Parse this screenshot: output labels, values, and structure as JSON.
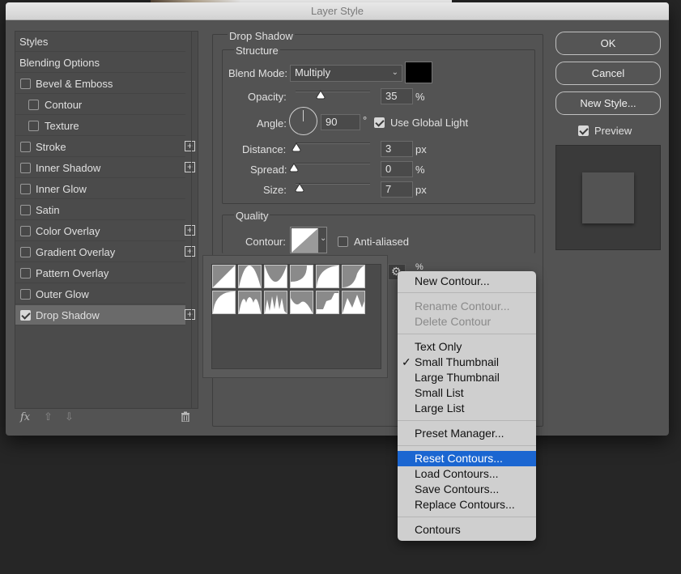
{
  "window": {
    "title": "Layer Style"
  },
  "styles_list": {
    "items": [
      {
        "label": "Styles",
        "checkbox": false,
        "checked": false,
        "plus": false,
        "indent": 0,
        "selected": false
      },
      {
        "label": "Blending Options",
        "checkbox": false,
        "checked": false,
        "plus": false,
        "indent": 0,
        "selected": false
      },
      {
        "label": "Bevel & Emboss",
        "checkbox": true,
        "checked": false,
        "plus": false,
        "indent": 0,
        "selected": false
      },
      {
        "label": "Contour",
        "checkbox": true,
        "checked": false,
        "plus": false,
        "indent": 1,
        "selected": false
      },
      {
        "label": "Texture",
        "checkbox": true,
        "checked": false,
        "plus": false,
        "indent": 1,
        "selected": false
      },
      {
        "label": "Stroke",
        "checkbox": true,
        "checked": false,
        "plus": true,
        "indent": 0,
        "selected": false
      },
      {
        "label": "Inner Shadow",
        "checkbox": true,
        "checked": false,
        "plus": true,
        "indent": 0,
        "selected": false
      },
      {
        "label": "Inner Glow",
        "checkbox": true,
        "checked": false,
        "plus": false,
        "indent": 0,
        "selected": false
      },
      {
        "label": "Satin",
        "checkbox": true,
        "checked": false,
        "plus": false,
        "indent": 0,
        "selected": false
      },
      {
        "label": "Color Overlay",
        "checkbox": true,
        "checked": false,
        "plus": true,
        "indent": 0,
        "selected": false
      },
      {
        "label": "Gradient Overlay",
        "checkbox": true,
        "checked": false,
        "plus": true,
        "indent": 0,
        "selected": false
      },
      {
        "label": "Pattern Overlay",
        "checkbox": true,
        "checked": false,
        "plus": false,
        "indent": 0,
        "selected": false
      },
      {
        "label": "Outer Glow",
        "checkbox": true,
        "checked": false,
        "plus": false,
        "indent": 0,
        "selected": false
      },
      {
        "label": "Drop Shadow",
        "checkbox": true,
        "checked": true,
        "plus": true,
        "indent": 0,
        "selected": true
      }
    ],
    "footer": {
      "fx": "fx",
      "up": "⇧",
      "down": "⇩",
      "trash": "🗑"
    }
  },
  "drop_shadow": {
    "title": "Drop Shadow",
    "structure": {
      "title": "Structure",
      "blend_mode_label": "Blend Mode:",
      "blend_mode_value": "Multiply",
      "shadow_color": "#000000",
      "opacity_label": "Opacity:",
      "opacity_value": "35",
      "opacity_unit": "%",
      "angle_label": "Angle:",
      "angle_value": "90",
      "angle_unit": "°",
      "global_light_label": "Use Global Light",
      "global_light_checked": true,
      "distance_label": "Distance:",
      "distance_value": "3",
      "distance_unit": "px",
      "spread_label": "Spread:",
      "spread_value": "0",
      "spread_unit": "%",
      "size_label": "Size:",
      "size_value": "7",
      "size_unit": "px"
    },
    "quality": {
      "title": "Quality",
      "contour_label": "Contour:",
      "anti_aliased_label": "Anti-aliased",
      "anti_aliased_checked": false,
      "noise_unit": "%"
    }
  },
  "buttons": {
    "ok": "OK",
    "cancel": "Cancel",
    "new_style": "New Style..."
  },
  "preview": {
    "label": "Preview",
    "checked": true
  },
  "contour_menu": {
    "items": [
      {
        "label": "New Contour...",
        "state": "normal",
        "check": false
      },
      {
        "label": "Rename Contour...",
        "state": "disabled",
        "check": false
      },
      {
        "label": "Delete Contour",
        "state": "disabled",
        "check": false
      },
      {
        "label": "Text Only",
        "state": "normal",
        "check": false
      },
      {
        "label": "Small Thumbnail",
        "state": "normal",
        "check": true
      },
      {
        "label": "Large Thumbnail",
        "state": "normal",
        "check": false
      },
      {
        "label": "Small List",
        "state": "normal",
        "check": false
      },
      {
        "label": "Large List",
        "state": "normal",
        "check": false
      },
      {
        "label": "Preset Manager...",
        "state": "normal",
        "check": false
      },
      {
        "label": "Reset Contours...",
        "state": "highlighted",
        "check": false
      },
      {
        "label": "Load Contours...",
        "state": "normal",
        "check": false
      },
      {
        "label": "Save Contours...",
        "state": "normal",
        "check": false
      },
      {
        "label": "Replace Contours...",
        "state": "normal",
        "check": false
      },
      {
        "label": "Contours",
        "state": "normal",
        "check": false
      }
    ],
    "checkmark": "✓"
  },
  "contour_presets": [
    "Linear",
    "Cone",
    "Cone - Inverted",
    "Cove - Deep",
    "Cove - Shallow",
    "Gaussian",
    "Half Round",
    "Ring",
    "Ring - Double",
    "Rolling Slope - Descending",
    "Rounded Steps",
    "Sawtooth 1"
  ]
}
